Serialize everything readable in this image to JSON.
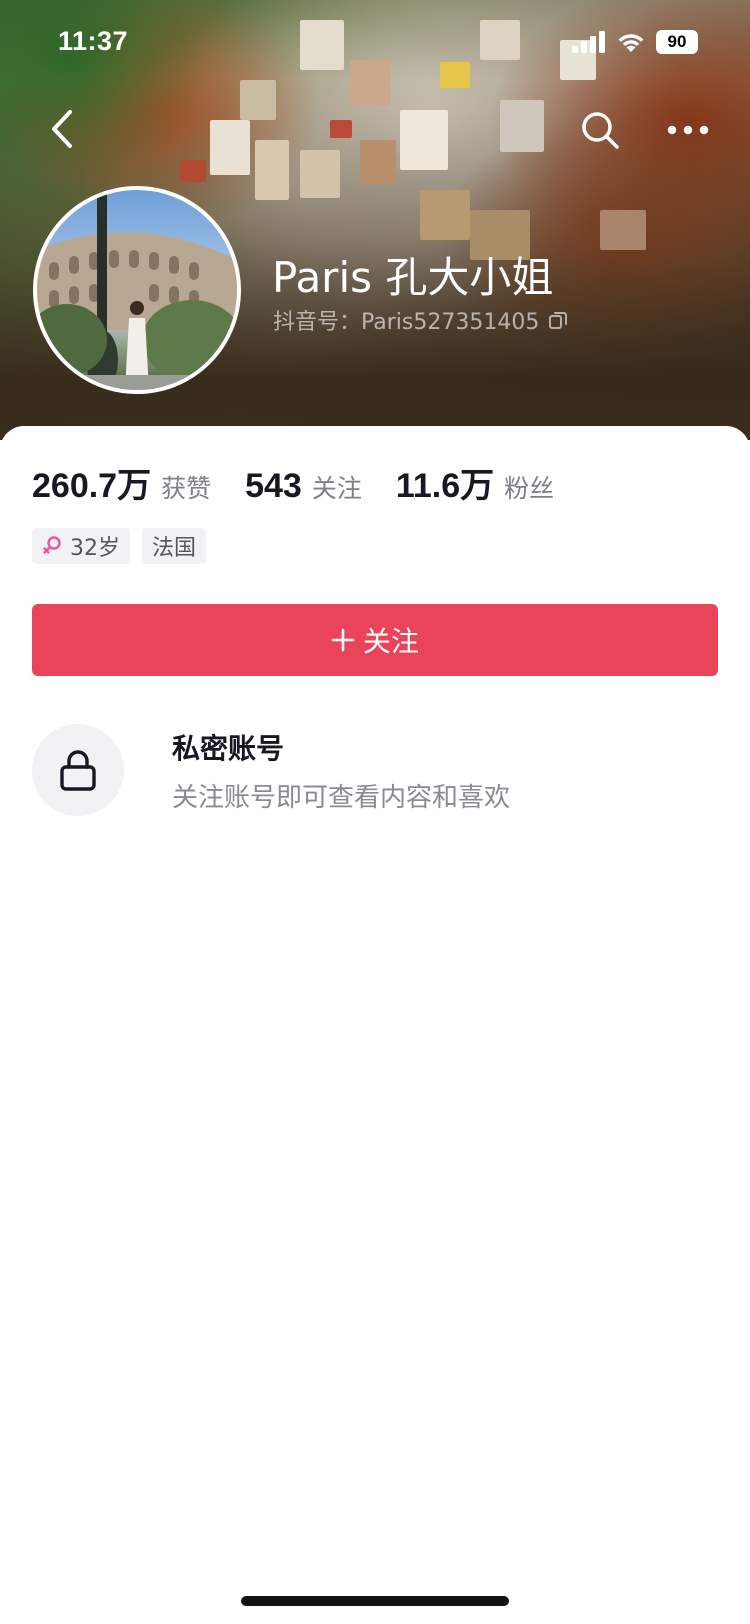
{
  "status_bar": {
    "time": "11:37",
    "battery": "90",
    "signal_icon": "cellular-signal-icon",
    "wifi_icon": "wifi-icon"
  },
  "nav": {
    "back_icon": "chevron-left-icon",
    "search_icon": "search-icon",
    "more_icon": "more-dots-icon"
  },
  "profile": {
    "name": "Paris 孔大小姐",
    "douyin_id": "抖音号：Paris527351405",
    "copy_icon": "copy-icon"
  },
  "stats": [
    {
      "value": "260.7万",
      "label": "获赞"
    },
    {
      "value": "543",
      "label": "关注"
    },
    {
      "value": "11.6万",
      "label": "粉丝"
    }
  ],
  "tags": {
    "gender_icon": "female-icon",
    "gender_color": "#f0569d",
    "age": "32岁",
    "location": "法国"
  },
  "follow_button": {
    "label": "关注",
    "color": "#ea445a"
  },
  "private_account": {
    "icon": "lock-icon",
    "title": "私密账号",
    "description": "关注账号即可查看内容和喜欢"
  }
}
